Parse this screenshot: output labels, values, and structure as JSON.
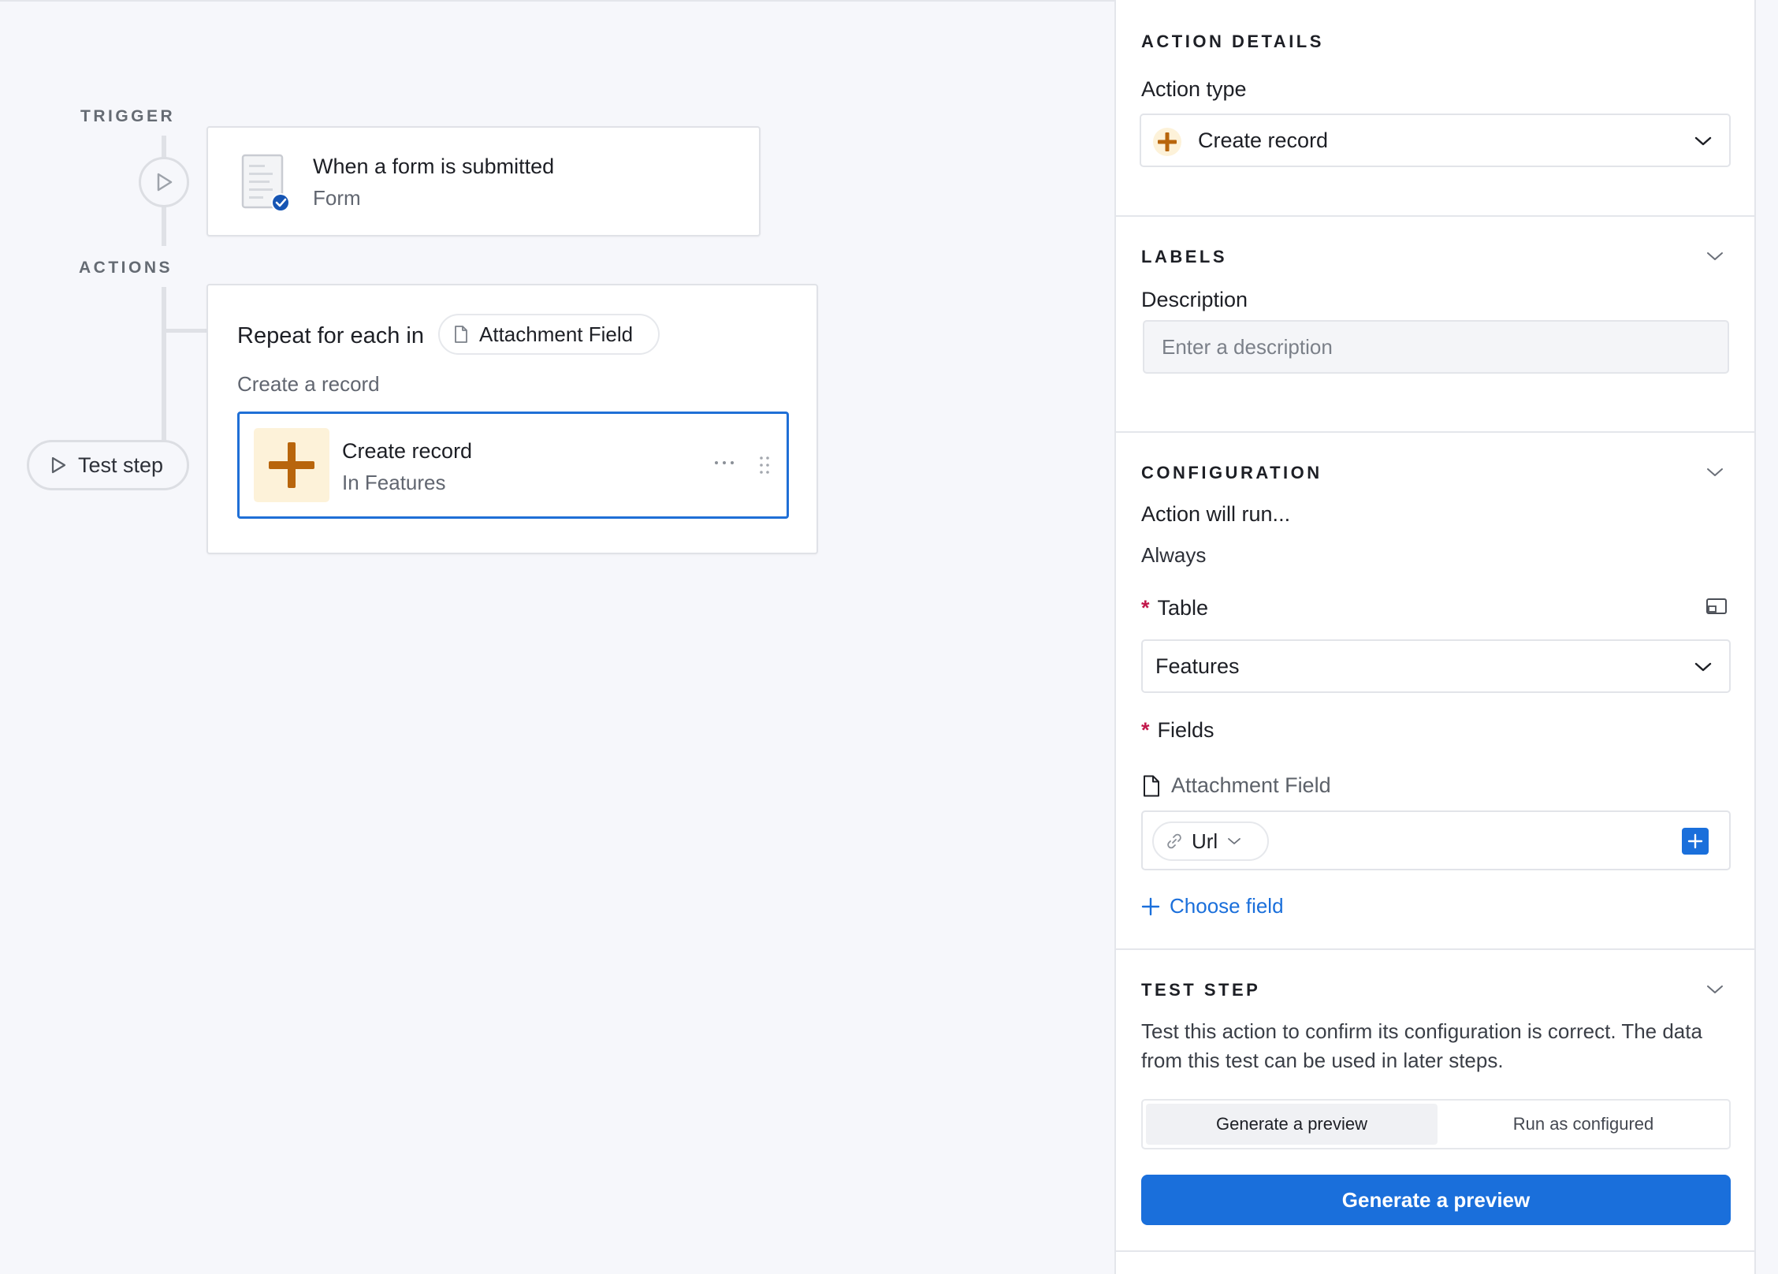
{
  "canvas": {
    "trigger_label": "TRIGGER",
    "actions_label": "ACTIONS",
    "trigger_card": {
      "title": "When a form is submitted",
      "subtitle": "Form"
    },
    "loop_card": {
      "title": "Repeat for each in",
      "chip_label": "Attachment Field",
      "subtitle": "Create a record",
      "action": {
        "title": "Create record",
        "subtitle": "In Features"
      }
    },
    "test_step_button": "Test step"
  },
  "panel": {
    "action_details": {
      "heading": "ACTION DETAILS",
      "action_type_label": "Action type",
      "action_type_value": "Create record"
    },
    "labels": {
      "heading": "LABELS",
      "description_label": "Description",
      "description_placeholder": "Enter a description",
      "description_value": ""
    },
    "configuration": {
      "heading": "CONFIGURATION",
      "run_label": "Action will run...",
      "run_value": "Always",
      "required_marker": "*",
      "table_label": "Table",
      "table_value": "Features",
      "fields_label": "Fields",
      "field_name": "Attachment Field",
      "field_value_chip": "Url",
      "choose_field": "Choose field"
    },
    "test_step": {
      "heading": "TEST STEP",
      "description": "Test this action to confirm its configuration is correct. The data from this test can be used in later steps.",
      "options": [
        "Generate a preview",
        "Run as configured"
      ],
      "selected_option": "Generate a preview",
      "primary_button": "Generate a preview"
    }
  },
  "colors": {
    "accent": "#1a6fdb",
    "selected_border": "#1f6fd6",
    "create_icon_bg": "#fdf2d9",
    "create_icon": "#b8650c",
    "required": "#c2184b",
    "canvas_bg": "#f6f7fb"
  },
  "icons": {
    "trigger_play": "play-icon",
    "form": "form-icon",
    "badge": "check-badge-icon",
    "attachment": "document-icon",
    "create": "plus-icon",
    "more": "ellipsis-icon",
    "drag": "drag-handle-icon",
    "chevron": "chevron-down-icon",
    "link": "link-icon",
    "layout": "panel-layout-icon"
  }
}
